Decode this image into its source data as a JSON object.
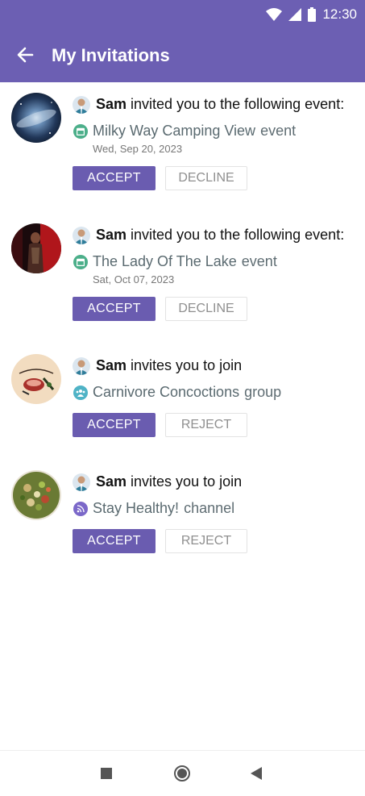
{
  "status_bar": {
    "time": "12:30",
    "icons": [
      "wifi-icon",
      "signal-icon",
      "battery-icon"
    ]
  },
  "app_bar": {
    "title": "My Invitations",
    "back_icon": "arrow-back-icon"
  },
  "colors": {
    "primary": "#6c5fb3",
    "accept": "#6a5cb0",
    "event_icon": "#4caf8a",
    "group_icon": "#4fb3c6",
    "channel_icon": "#7b68c9"
  },
  "invitations": [
    {
      "sender": "Sam",
      "message": " invited you to the following event:",
      "target_icon": "calendar-icon",
      "target_name": "Milky Way Camping View",
      "target_kind": "event",
      "date": "Wed, Sep 20, 2023",
      "accept_label": "ACCEPT",
      "secondary_label": "DECLINE"
    },
    {
      "sender": "Sam",
      "message": " invited you to the following event:",
      "target_icon": "calendar-icon",
      "target_name": "The Lady Of The Lake",
      "target_kind": "event",
      "date": "Sat, Oct 07, 2023",
      "accept_label": "ACCEPT",
      "secondary_label": "DECLINE"
    },
    {
      "sender": "Sam",
      "message": " invites you to join",
      "target_icon": "group-icon",
      "target_name": "Carnivore Concoctions",
      "target_kind": "group",
      "accept_label": "ACCEPT",
      "secondary_label": "REJECT"
    },
    {
      "sender": "Sam",
      "message": " invites you to join",
      "target_icon": "rss-icon",
      "target_name": "Stay Healthy!",
      "target_kind": "channel",
      "accept_label": "ACCEPT",
      "secondary_label": "REJECT"
    }
  ],
  "nav_bar": {
    "icons": [
      "recents-square-icon",
      "home-circle-icon",
      "back-triangle-icon"
    ]
  }
}
